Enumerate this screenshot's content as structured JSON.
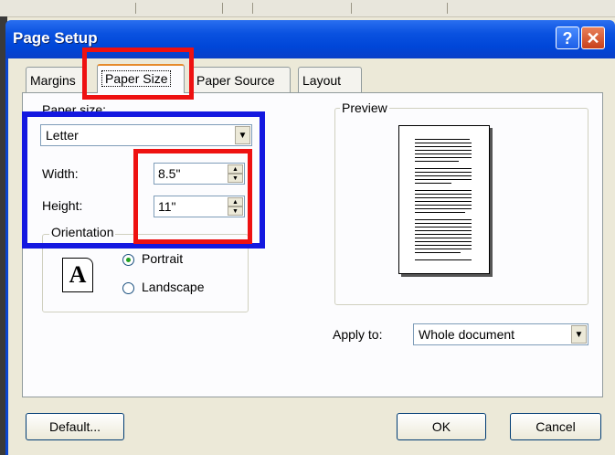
{
  "window": {
    "title": "Page Setup",
    "help_glyph": "?",
    "close_glyph": "✕"
  },
  "tabs": [
    {
      "label": "Margins",
      "active": false
    },
    {
      "label": "Paper Size",
      "active": true
    },
    {
      "label": "Paper Source",
      "active": false
    },
    {
      "label": "Layout",
      "active": false
    }
  ],
  "paper_size": {
    "label": "Paper size:",
    "value": "Letter"
  },
  "width": {
    "label": "Width:",
    "value": "8.5\""
  },
  "height": {
    "label": "Height:",
    "value": "11\""
  },
  "orientation": {
    "label": "Orientation",
    "icon_glyph": "A",
    "options": [
      {
        "label": "Portrait",
        "checked": true
      },
      {
        "label": "Landscape",
        "checked": false
      }
    ]
  },
  "preview": {
    "label": "Preview"
  },
  "apply_to": {
    "label": "Apply to:",
    "value": "Whole document"
  },
  "buttons": {
    "default": "Default...",
    "ok": "OK",
    "cancel": "Cancel"
  },
  "highlight_colors": {
    "red": "#ee1111",
    "blue": "#1418e0"
  }
}
